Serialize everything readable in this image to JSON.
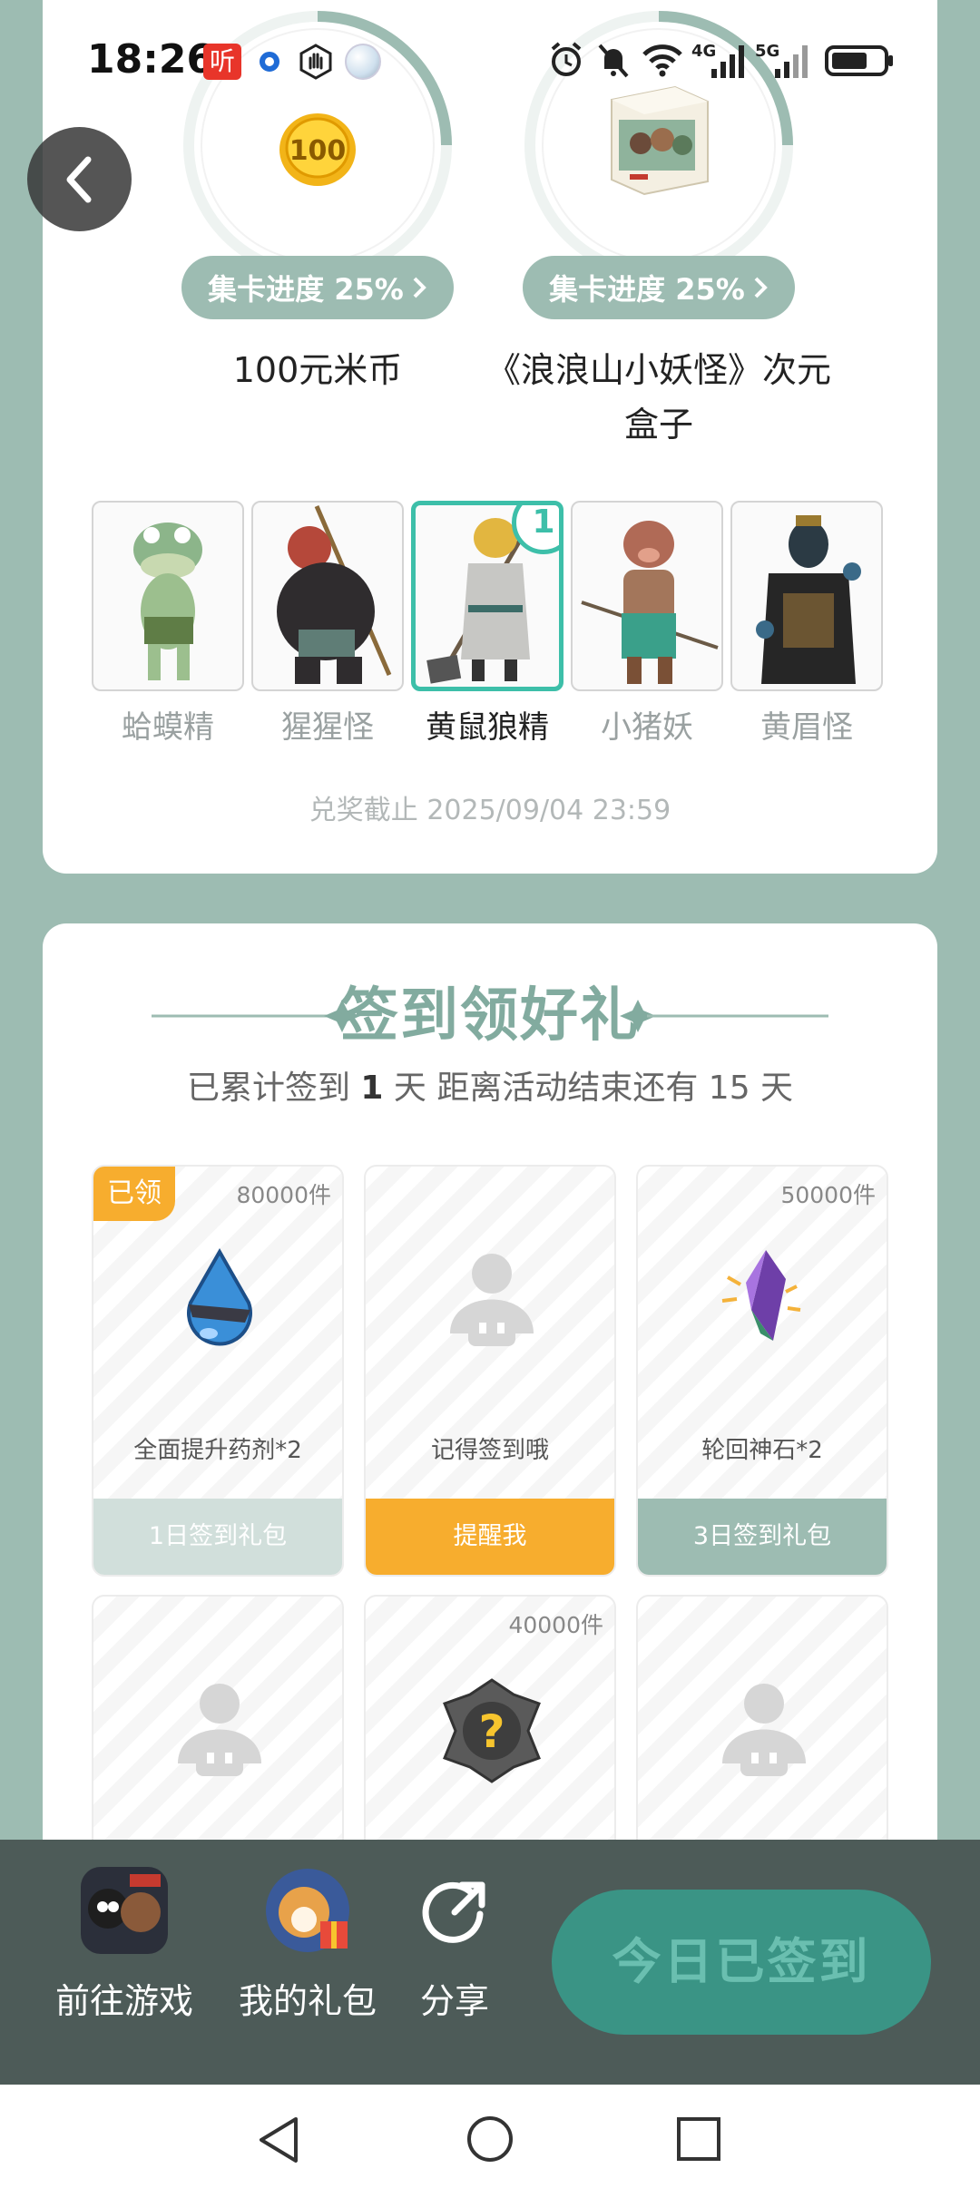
{
  "status_bar": {
    "time": "18:26",
    "ting_badge": "听",
    "network_4g": "4G",
    "network_5g": "5G"
  },
  "prizes": [
    {
      "name": "100元米币",
      "progress_label": "集卡进度 25%",
      "image_text": "100"
    },
    {
      "name": "《浪浪山小妖怪》次元盒子",
      "progress_label": "集卡进度 25%"
    }
  ],
  "characters": [
    {
      "name": "蛤蟆精",
      "selected": false
    },
    {
      "name": "猩猩怪",
      "selected": false
    },
    {
      "name": "黄鼠狼精",
      "selected": true,
      "count": "1"
    },
    {
      "name": "小猪妖",
      "selected": false
    },
    {
      "name": "黄眉怪",
      "selected": false
    }
  ],
  "deadline": "兑奖截止 2025/09/04 23:59",
  "checkin": {
    "title": "签到领好礼",
    "info_prefix": "已累计签到",
    "days": "1",
    "info_suffix": "天  距离活动结束还有 15 天"
  },
  "rewards": [
    {
      "qty": "80000件",
      "claimed_label": "已领",
      "name": "全面提升药剂*2",
      "button": "1日签到礼包",
      "state": "claimed"
    },
    {
      "qty": "",
      "name": "记得签到哦",
      "button": "提醒我",
      "state": "remind"
    },
    {
      "qty": "50000件",
      "name": "轮回神石*2",
      "button": "3日签到礼包",
      "state": "upcoming"
    },
    {
      "qty": "",
      "name": "",
      "button": "",
      "state": "locked"
    },
    {
      "qty": "40000件",
      "name": "",
      "button": "",
      "state": "mystery"
    },
    {
      "qty": "",
      "name": "",
      "button": "",
      "state": "locked"
    }
  ],
  "bottom_bar": {
    "go_game": "前往游戏",
    "my_gifts": "我的礼包",
    "share": "分享",
    "signed_today": "今日已签到"
  },
  "colors": {
    "background": "#9dbcb2",
    "accent_teal": "#3dbfa9",
    "claimed_orange": "#f7ad2e",
    "bottom_bar": "#4d5b58",
    "signed_button": "#3a9485"
  }
}
